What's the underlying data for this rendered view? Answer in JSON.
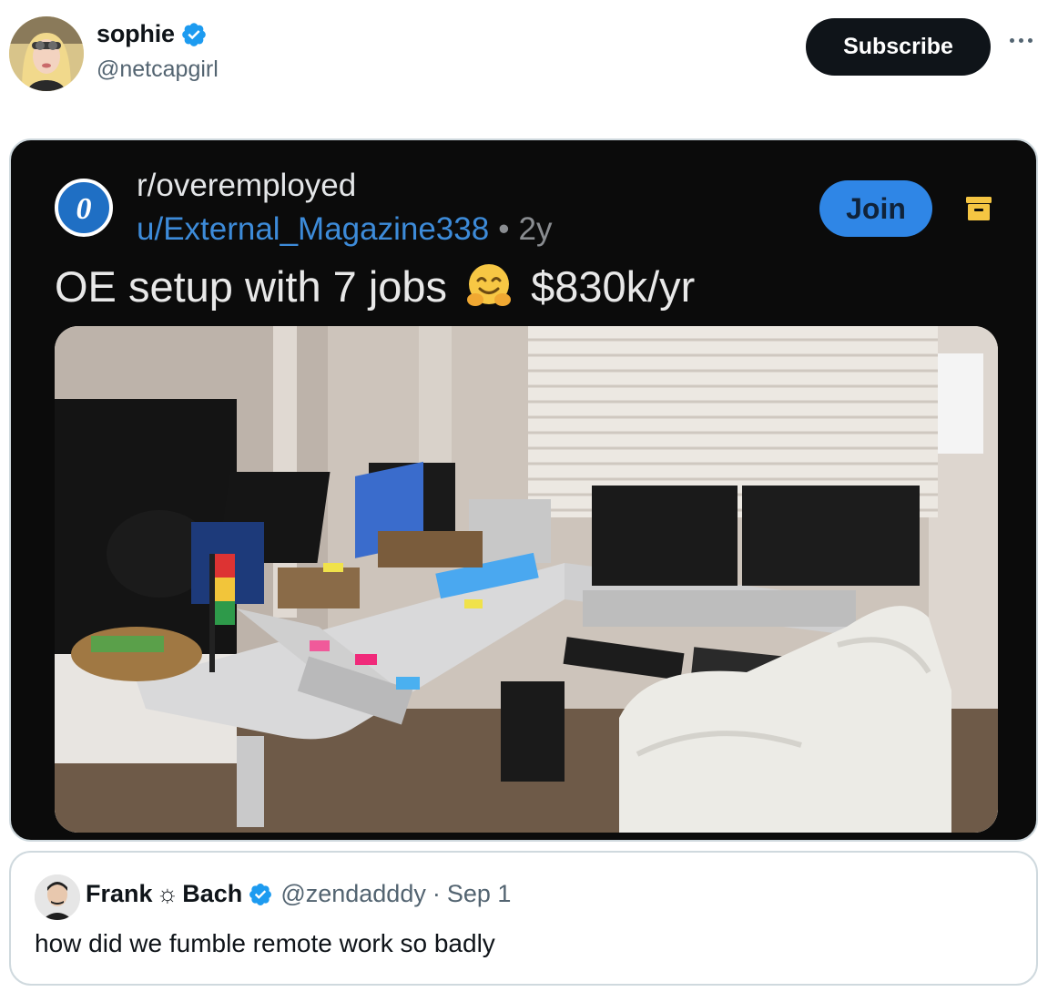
{
  "author": {
    "display_name": "sophie",
    "handle": "@netcapgirl",
    "verified": true
  },
  "subscribe_label": "Subscribe",
  "embedded_post": {
    "subreddit": "r/overemployed",
    "user": "u/External_Magazine338",
    "separator": "•",
    "age": "2y",
    "join_label": "Join",
    "title_left": "OE setup with 7 jobs",
    "title_emoji": "hugging-face-emoji",
    "title_right": "$830k/yr",
    "photo": "desk-setup-with-many-laptops-photo"
  },
  "quoted_tweet": {
    "name_first": "Frank",
    "name_symbol": "☼",
    "name_last": "Bach",
    "handle": "@zendadddy",
    "separator": "·",
    "date": "Sep 1",
    "text": "how did we fumble remote work so badly"
  },
  "colors": {
    "verified": "#1d9bf0",
    "subscribe_bg": "#0f1419",
    "card_bg": "#0b0b0b",
    "join_bg": "#2f86e6",
    "reddit_user_link": "#3d8bd9"
  }
}
